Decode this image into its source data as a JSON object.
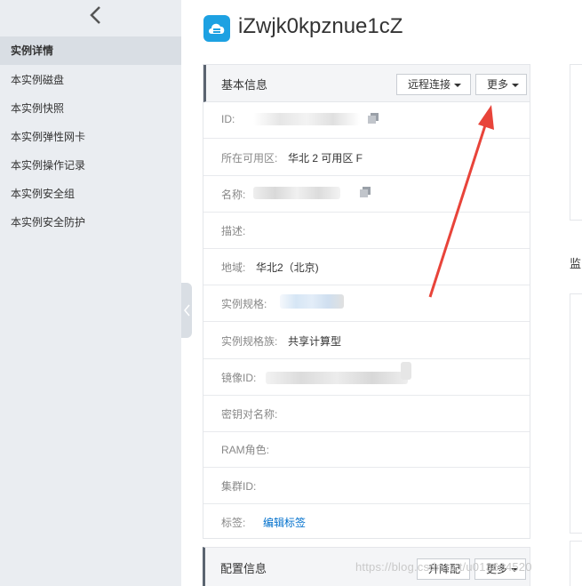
{
  "sidebar": {
    "back_icon": "chevron-left-icon",
    "items": [
      {
        "label": "实例详情",
        "active": true
      },
      {
        "label": "本实例磁盘",
        "active": false
      },
      {
        "label": "本实例快照",
        "active": false
      },
      {
        "label": "本实例弹性网卡",
        "active": false
      },
      {
        "label": "本实例操作记录",
        "active": false
      },
      {
        "label": "本实例安全组",
        "active": false
      },
      {
        "label": "本实例安全防护",
        "active": false
      }
    ]
  },
  "header": {
    "icon": "cloud-server-icon",
    "title": "iZwjk0kpznue1cZ",
    "accent_color": "#1da1e2"
  },
  "basic_info": {
    "title": "基本信息",
    "remote_connect_label": "远程连接",
    "more_label": "更多",
    "fields": [
      {
        "label": "ID:",
        "value": ""
      },
      {
        "label": "所在可用区:",
        "value": "华北 2 可用区 F"
      },
      {
        "label": "名称:",
        "value": ""
      },
      {
        "label": "描述:",
        "value": ""
      },
      {
        "label": "地域:",
        "value": "华北2（北京)"
      },
      {
        "label": "实例规格:",
        "value": ""
      },
      {
        "label": "实例规格族:",
        "value": "共享计算型"
      },
      {
        "label": "镜像ID:",
        "value": ""
      },
      {
        "label": "密钥对名称:",
        "value": ""
      },
      {
        "label": "RAM角色:",
        "value": ""
      },
      {
        "label": "集群ID:",
        "value": ""
      },
      {
        "label": "标签:",
        "value": "编辑标签"
      }
    ]
  },
  "config_info": {
    "title": "配置信息",
    "upgrade_label": "升降配",
    "more_label": "更多"
  },
  "right": {
    "partial_label": "监"
  },
  "watermark": "https://blog.csdn.net/u013604520",
  "annotation_arrow_color": "#e8443a"
}
